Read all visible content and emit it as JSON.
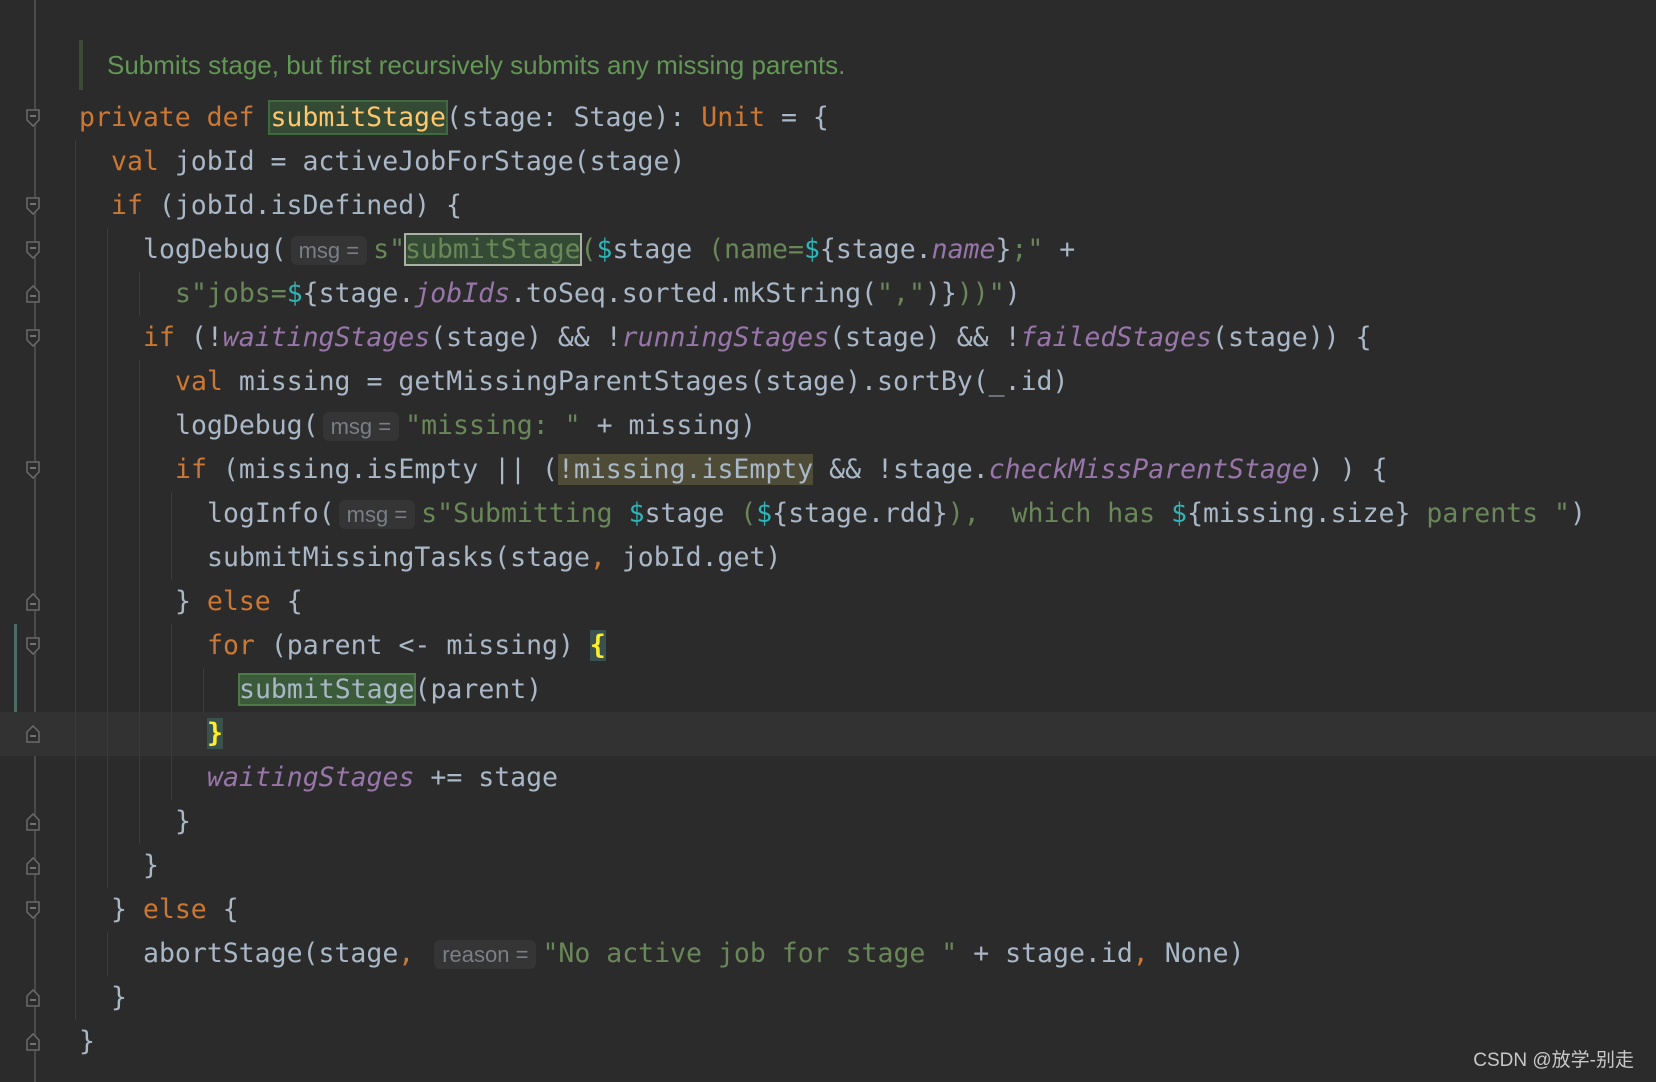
{
  "doc_comment": "Submits stage, but first recursively submits any missing parents.",
  "watermark": "CSDN @放学-别走",
  "colors": {
    "background": "#2b2b2b",
    "keyword": "#cc7832",
    "string": "#6a8759",
    "field": "#9876aa",
    "function_decl": "#ffc66d",
    "interpolation": "#2fb5b5",
    "default": "#a9b7c6"
  },
  "lines": [
    {
      "indent": 0,
      "fold": "open",
      "tokens": [
        {
          "t": "private def ",
          "c": "k"
        },
        {
          "t": "submitStage",
          "c": "fn"
        },
        {
          "t": "(stage: Stage): ",
          "c": "d"
        },
        {
          "t": "Unit",
          "c": "k"
        },
        {
          "t": " = {",
          "c": "d"
        }
      ]
    },
    {
      "indent": 1,
      "tokens": [
        {
          "t": "val ",
          "c": "k"
        },
        {
          "t": "jobId = activeJobForStage(stage)",
          "c": "d"
        }
      ]
    },
    {
      "indent": 1,
      "fold": "open",
      "tokens": [
        {
          "t": "if ",
          "c": "k"
        },
        {
          "t": "(jobId.isDefined) {",
          "c": "d"
        }
      ]
    },
    {
      "indent": 2,
      "fold": "open",
      "tokens": [
        {
          "t": "logDebug(",
          "c": "d"
        },
        {
          "t": "msg =",
          "c": "hint"
        },
        {
          "t": "s\"",
          "c": "s"
        },
        {
          "t": "submitStage",
          "c": "box"
        },
        {
          "t": "(",
          "c": "s"
        },
        {
          "t": "$",
          "c": "t"
        },
        {
          "t": "stage",
          "c": "d"
        },
        {
          "t": " (name=",
          "c": "s"
        },
        {
          "t": "$",
          "c": "t"
        },
        {
          "t": "{stage.",
          "c": "d"
        },
        {
          "t": "name",
          "c": "p"
        },
        {
          "t": "}",
          "c": "d"
        },
        {
          "t": ";\"",
          "c": "s"
        },
        {
          "t": " +",
          "c": "d"
        }
      ]
    },
    {
      "indent": 3,
      "fold": "close",
      "tokens": [
        {
          "t": "s\"jobs=",
          "c": "s"
        },
        {
          "t": "$",
          "c": "t"
        },
        {
          "t": "{stage.",
          "c": "d"
        },
        {
          "t": "jobIds",
          "c": "p"
        },
        {
          "t": ".toSeq.sorted.mkString(",
          "c": "d"
        },
        {
          "t": "\",\"",
          "c": "s"
        },
        {
          "t": ")}",
          "c": "d"
        },
        {
          "t": "))\"",
          "c": "s"
        },
        {
          "t": ")",
          "c": "d"
        }
      ]
    },
    {
      "indent": 2,
      "fold": "open",
      "tokens": [
        {
          "t": "if ",
          "c": "k"
        },
        {
          "t": "(!",
          "c": "d"
        },
        {
          "t": "waitingStages",
          "c": "p"
        },
        {
          "t": "(stage) && !",
          "c": "d"
        },
        {
          "t": "runningStages",
          "c": "p"
        },
        {
          "t": "(stage) && !",
          "c": "d"
        },
        {
          "t": "failedStages",
          "c": "p"
        },
        {
          "t": "(stage)) {",
          "c": "d"
        }
      ]
    },
    {
      "indent": 3,
      "tokens": [
        {
          "t": "val ",
          "c": "k"
        },
        {
          "t": "missing = getMissingParentStages(stage).sortBy(_.id)",
          "c": "d"
        }
      ]
    },
    {
      "indent": 3,
      "tokens": [
        {
          "t": "logDebug(",
          "c": "d"
        },
        {
          "t": "msg =",
          "c": "hint"
        },
        {
          "t": "\"missing: \"",
          "c": "s"
        },
        {
          "t": " + missing)",
          "c": "d"
        }
      ]
    },
    {
      "indent": 3,
      "fold": "open",
      "tokens": [
        {
          "t": "if ",
          "c": "k"
        },
        {
          "t": "(missing.isEmpty || (",
          "c": "d"
        },
        {
          "t": "!missing.isEmpty",
          "c": "olive"
        },
        {
          "t": " && !stage.",
          "c": "d"
        },
        {
          "t": "checkMissParentStage",
          "c": "p"
        },
        {
          "t": ") ) {",
          "c": "d"
        }
      ]
    },
    {
      "indent": 4,
      "tokens": [
        {
          "t": "logInfo(",
          "c": "d"
        },
        {
          "t": "msg =",
          "c": "hint"
        },
        {
          "t": "s\"Submitting ",
          "c": "s"
        },
        {
          "t": "$",
          "c": "t"
        },
        {
          "t": "stage",
          "c": "d"
        },
        {
          "t": " (",
          "c": "s"
        },
        {
          "t": "$",
          "c": "t"
        },
        {
          "t": "{stage.rdd}",
          "c": "d"
        },
        {
          "t": "),  which has ",
          "c": "s"
        },
        {
          "t": "$",
          "c": "t"
        },
        {
          "t": "{missing.size}",
          "c": "d"
        },
        {
          "t": " parents \"",
          "c": "s"
        },
        {
          "t": ")",
          "c": "d"
        }
      ]
    },
    {
      "indent": 4,
      "tokens": [
        {
          "t": "submitMissingTasks(stage",
          "c": "d"
        },
        {
          "t": ",",
          "c": "o"
        },
        {
          "t": " jobId.get)",
          "c": "d"
        }
      ]
    },
    {
      "indent": 3,
      "fold": "close",
      "tokens": [
        {
          "t": "} ",
          "c": "d"
        },
        {
          "t": "else",
          "c": "k"
        },
        {
          "t": " {",
          "c": "d"
        }
      ]
    },
    {
      "indent": 4,
      "fold": "open",
      "tokens": [
        {
          "t": "for ",
          "c": "k"
        },
        {
          "t": "(parent <- missing) ",
          "c": "d"
        },
        {
          "t": "{",
          "c": "brace"
        }
      ]
    },
    {
      "indent": 5,
      "tokens": [
        {
          "t": "submitStage",
          "c": "hl"
        },
        {
          "t": "(parent)",
          "c": "d"
        }
      ]
    },
    {
      "indent": 4,
      "fold": "close",
      "current": true,
      "tokens": [
        {
          "t": "}",
          "c": "brace"
        }
      ]
    },
    {
      "indent": 4,
      "tokens": [
        {
          "t": "waitingStages",
          "c": "p"
        },
        {
          "t": " += stage",
          "c": "d"
        }
      ]
    },
    {
      "indent": 3,
      "fold": "close",
      "tokens": [
        {
          "t": "}",
          "c": "d"
        }
      ]
    },
    {
      "indent": 2,
      "fold": "close",
      "tokens": [
        {
          "t": "}",
          "c": "d"
        }
      ]
    },
    {
      "indent": 1,
      "fold": "open",
      "tokens": [
        {
          "t": "} ",
          "c": "d"
        },
        {
          "t": "else",
          "c": "k"
        },
        {
          "t": " {",
          "c": "d"
        }
      ]
    },
    {
      "indent": 2,
      "tokens": [
        {
          "t": "abortStage(stage",
          "c": "d"
        },
        {
          "t": ",",
          "c": "o"
        },
        {
          "t": " ",
          "c": "d"
        },
        {
          "t": "reason =",
          "c": "hint"
        },
        {
          "t": "\"No active job for stage \"",
          "c": "s"
        },
        {
          "t": " + stage.id",
          "c": "d"
        },
        {
          "t": ",",
          "c": "o"
        },
        {
          "t": " None)",
          "c": "d"
        }
      ]
    },
    {
      "indent": 1,
      "fold": "close",
      "tokens": [
        {
          "t": "}",
          "c": "d"
        }
      ]
    },
    {
      "indent": 0,
      "fold": "close",
      "tokens": [
        {
          "t": "}",
          "c": "d"
        }
      ]
    }
  ]
}
